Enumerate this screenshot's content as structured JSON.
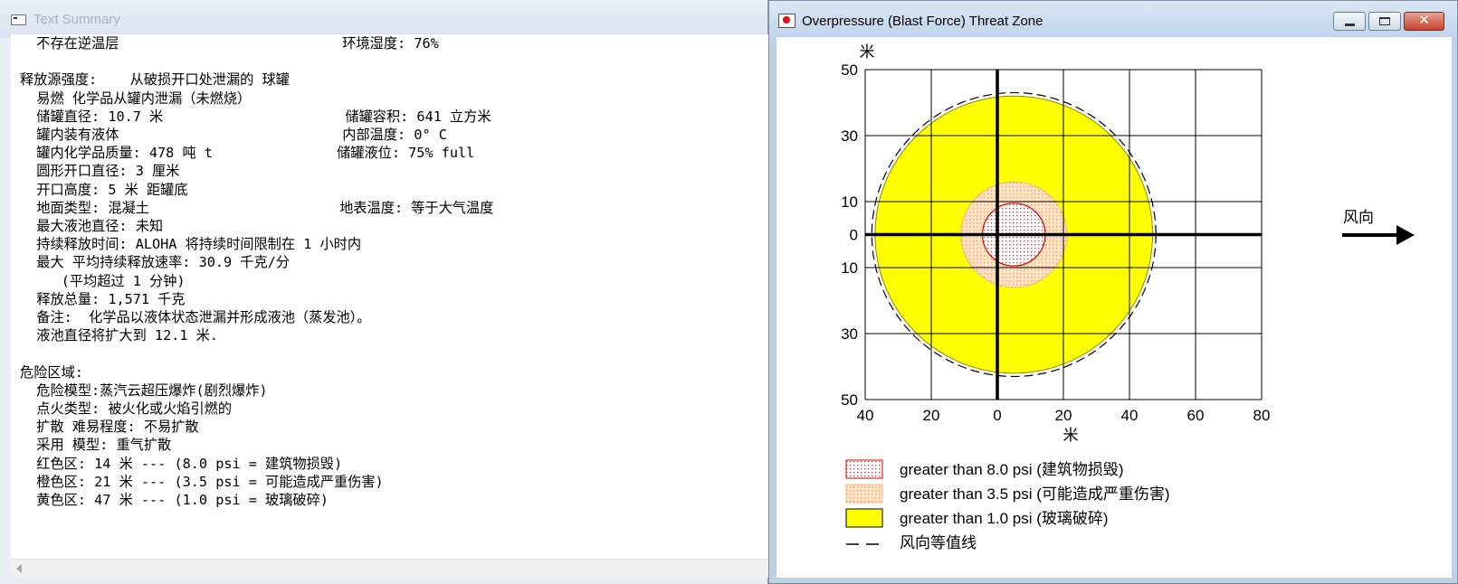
{
  "text_window": {
    "title": "Text Summary",
    "lines": [
      "  不存在逆温层                           环境湿度: 76%",
      "",
      "释放源强度:    从破损开口处泄漏的 球罐",
      "  易燃 化学品从罐内泄漏（未燃烧）",
      "  储罐直径: 10.7 米                      储罐容积: 641 立方米",
      "  罐内装有液体                           内部温度: 0° C",
      "  罐内化学品质量: 478 吨 t               储罐液位: 75% full",
      "  圆形开口直径: 3 厘米",
      "  开口高度: 5 米 距罐底",
      "  地面类型: 混凝土                       地表温度: 等于大气温度",
      "  最大液池直径: 未知",
      "  持续释放时间: ALOHA 将持续时间限制在 1 小时内",
      "  最大 平均持续释放速率: 30.9 千克/分",
      "     (平均超过 1 分钟)",
      "  释放总量: 1,571 千克",
      "  备注:  化学品以液体状态泄漏并形成液池（蒸发池）。",
      "  液池直径将扩大到 12.1 米.",
      "",
      "危险区域:",
      "  危险模型:蒸汽云超压爆炸(剧烈爆炸)",
      "  点火类型: 被火化或火焰引燃的",
      "  扩散 难易程度: 不易扩散",
      "  采用 模型: 重气扩散",
      "  红色区: 14 米 --- (8.0 psi = 建筑物损毁)",
      "  橙色区: 21 米 --- (3.5 psi = 可能造成严重伤害)",
      "  黄色区: 47 米 --- (1.0 psi = 玻璃破碎)"
    ]
  },
  "map_window": {
    "title": "Overpressure (Blast Force) Threat Zone",
    "buttons": {
      "minimize": "minimize",
      "maximize": "maximize",
      "close": "✕"
    },
    "y_unit_label": "米",
    "x_unit_label": "米",
    "wind_label": "风向",
    "x_ticks": [
      40,
      20,
      0,
      20,
      40,
      60,
      80
    ],
    "y_ticks": [
      50,
      30,
      10,
      0,
      10,
      30,
      50
    ],
    "legend": [
      {
        "label": "greater than 8.0 psi (建筑物损毁)",
        "color": "#ff0000",
        "pattern": "red-dots"
      },
      {
        "label": "greater than 3.5 psi (可能造成严重伤害)",
        "color": "#ffcc99",
        "pattern": "orange-dots"
      },
      {
        "label": "greater than 1.0 psi (玻璃破碎)",
        "color": "#ffff00",
        "pattern": "solid-yellow"
      },
      {
        "label": "风向等值线",
        "color": "#000000",
        "pattern": "dashed-line"
      }
    ]
  },
  "chart_data": {
    "type": "threat-zone-map",
    "x_unit": "米",
    "y_unit": "米",
    "xlim": [
      -40,
      80
    ],
    "ylim": [
      -50,
      50
    ],
    "grid": true,
    "zones": [
      {
        "name": "greater than 1.0 psi (玻璃破碎)",
        "color": "#ffff00",
        "center_x": 5,
        "center_y": 0,
        "radius": 42
      },
      {
        "name": "greater than 3.5 psi (可能造成严重伤害)",
        "color": "#ffcc99",
        "center_x": 5,
        "center_y": 0,
        "radius": 16
      },
      {
        "name": "greater than 8.0 psi (建筑物损毁)",
        "color": "#ff0000",
        "center_x": 5,
        "center_y": 0,
        "radius": 9.5
      }
    ],
    "confidence_line": {
      "center_x": 5,
      "center_y": 0,
      "radius": 43
    },
    "wind_direction": "east"
  }
}
